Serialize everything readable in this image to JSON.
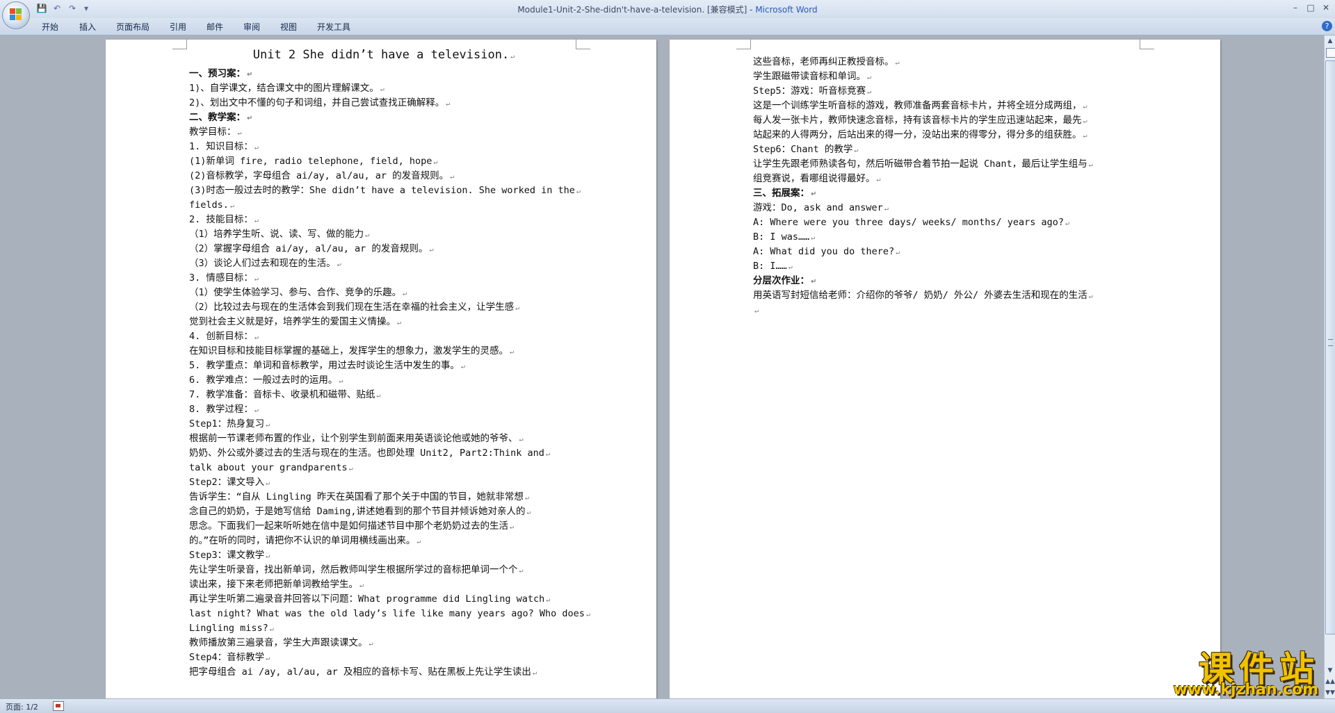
{
  "window": {
    "title": "Module1-Unit-2-She-didn't-have-a-television. [兼容模式] - ",
    "app": "Microsoft Word",
    "controls": [
      "–",
      "□",
      "✕"
    ]
  },
  "quick_access": {
    "save": "💾",
    "undo": "↶",
    "redo": "↷",
    "customize": "▾"
  },
  "ribbon": {
    "tabs": [
      "开始",
      "插入",
      "页面布局",
      "引用",
      "邮件",
      "审阅",
      "视图",
      "开发工具"
    ],
    "help": "?"
  },
  "page1_lines": [
    {
      "text": "Unit 2 She didn’t have a television.",
      "style": "title"
    },
    {
      "text": "一、预习案：",
      "style": "head"
    },
    {
      "text": "1)、自学课文，结合课文中的图片理解课文。",
      "style": ""
    },
    {
      "text": "2)、划出文中不懂的句子和词组，并自己尝试查找正确解释。",
      "style": ""
    },
    {
      "text": "二、教学案：",
      "style": "head"
    },
    {
      "text": "教学目标：",
      "style": ""
    },
    {
      "text": "1. 知识目标：",
      "style": ""
    },
    {
      "text": "(1)新单词 fire, radio telephone, field, hope",
      "style": ""
    },
    {
      "text": "(2)音标教学，字母组合 ai/ay, al/au, ar 的发音规则。",
      "style": ""
    },
    {
      "text": "(3)时态一般过去时的教学：She didn’t have a television. She worked in the",
      "style": ""
    },
    {
      "text": "fields.",
      "style": ""
    },
    {
      "text": "2. 技能目标：",
      "style": ""
    },
    {
      "text": "（1）培养学生听、说、读、写、做的能力",
      "style": ""
    },
    {
      "text": "（2）掌握字母组合 ai/ay, al/au, ar 的发音规则。",
      "style": ""
    },
    {
      "text": "（3）谈论人们过去和现在的生活。",
      "style": ""
    },
    {
      "text": "3. 情感目标：",
      "style": ""
    },
    {
      "text": "（1）使学生体验学习、参与、合作、竞争的乐趣。",
      "style": ""
    },
    {
      "text": "（2）比较过去与现在的生活体会到我们现在生活在幸福的社会主义，让学生感",
      "style": ""
    },
    {
      "text": "觉到社会主义就是好，培养学生的爱国主义情操。",
      "style": ""
    },
    {
      "text": "4. 创新目标：",
      "style": ""
    },
    {
      "text": "在知识目标和技能目标掌握的基础上，发挥学生的想象力，激发学生的灵感。",
      "style": ""
    },
    {
      "text": "5. 教学重点：单词和音标教学，用过去时谈论生活中发生的事。",
      "style": ""
    },
    {
      "text": "6. 教学难点：一般过去时的运用。",
      "style": ""
    },
    {
      "text": "7. 教学准备：音标卡、收录机和磁带、贴纸",
      "style": ""
    },
    {
      "text": "8. 教学过程：",
      "style": ""
    },
    {
      "text": "Step1：热身复习",
      "style": ""
    },
    {
      "text": "根据前一节课老师布置的作业，让个别学生到前面来用英语谈论他或她的爷爷、",
      "style": ""
    },
    {
      "text": "奶奶、外公或外婆过去的生活与现在的生活。也即处理 Unit2, Part2:Think and",
      "style": ""
    },
    {
      "text": "talk about your grandparents",
      "style": ""
    },
    {
      "text": "Step2：课文导入",
      "style": ""
    },
    {
      "text": "告诉学生：“自从 Lingling 昨天在英国看了那个关于中国的节目，她就非常想",
      "style": ""
    },
    {
      "text": "念自己的奶奶，于是她写信给 Daming,讲述她看到的那个节目并倾诉她对亲人的",
      "style": ""
    },
    {
      "text": "思念。下面我们一起来听听她在信中是如何描述节目中那个老奶奶过去的生活",
      "style": ""
    },
    {
      "text": "的。”在听的同时，请把你不认识的单词用横线画出来。",
      "style": ""
    },
    {
      "text": "Step3：课文教学",
      "style": ""
    },
    {
      "text": "先让学生听录音，找出新单词，然后教师叫学生根据所学过的音标把单词一个个",
      "style": ""
    },
    {
      "text": "读出来，接下来老师把新单词教给学生。",
      "style": ""
    },
    {
      "text": "再让学生听第二遍录音并回答以下问题：What programme did Lingling watch",
      "style": ""
    },
    {
      "text": "last night? What was the old lady’s life like many years ago? Who does",
      "style": ""
    },
    {
      "text": "Lingling miss?",
      "style": ""
    },
    {
      "text": "教师播放第三遍录音，学生大声跟读课文。",
      "style": ""
    },
    {
      "text": "Step4：音标教学",
      "style": ""
    },
    {
      "text": "把字母组合 ai /ay, al/au, ar 及相应的音标卡写、贴在黑板上先让学生读出",
      "style": ""
    }
  ],
  "page2_lines": [
    {
      "text": "这些音标，老师再纠正教授音标。",
      "style": ""
    },
    {
      "text": "学生跟磁带读音标和单词。",
      "style": ""
    },
    {
      "text": "Step5：游戏：听音标竞赛",
      "style": ""
    },
    {
      "text": "这是一个训练学生听音标的游戏，教师准备两套音标卡片，并将全班分成两组，",
      "style": ""
    },
    {
      "text": "每人发一张卡片，教师快速念音标，持有该音标卡片的学生应迅速站起来，最先",
      "style": ""
    },
    {
      "text": "站起来的人得两分，后站出来的得一分，没站出来的得零分，得分多的组获胜。",
      "style": ""
    },
    {
      "text": "Step6：Chant 的教学",
      "style": ""
    },
    {
      "text": "让学生先跟老师熟读各句，然后听磁带合着节拍一起说 Chant，最后让学生组与",
      "style": ""
    },
    {
      "text": "组竞赛说，看哪组说得最好。",
      "style": ""
    },
    {
      "text": "三、拓展案：",
      "style": "head"
    },
    {
      "text": "游戏：Do, ask and answer",
      "style": ""
    },
    {
      "text": "A: Where were you three days/ weeks/ months/ years ago?",
      "style": ""
    },
    {
      "text": "B: I was……",
      "style": ""
    },
    {
      "text": "A: What did you do there?",
      "style": ""
    },
    {
      "text": "B: I……",
      "style": ""
    },
    {
      "text": "分层次作业：",
      "style": "head"
    },
    {
      "text": "用英语写封短信给老师：介绍你的爷爷/ 奶奶/ 外公/ 外婆去生活和现在的生活",
      "style": ""
    },
    {
      "text": "",
      "style": ""
    }
  ],
  "paragraph_mark": "↵",
  "status": {
    "page_count": "页面: 1/2"
  },
  "scrollbar": {
    "up": "▲",
    "down": "▼",
    "prev": "▲▲",
    "next": "▼▼"
  },
  "watermark": {
    "main": "课件站",
    "url": "www.kjzhan.com"
  },
  "colors": {
    "accent": "#2a5bb3",
    "watermark": "#f2c200"
  }
}
